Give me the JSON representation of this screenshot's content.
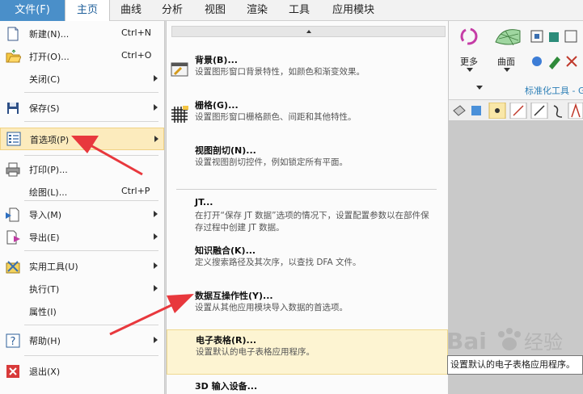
{
  "menubar": {
    "items": [
      {
        "label": "文件(F)"
      },
      {
        "label": "主页"
      },
      {
        "label": "曲线"
      },
      {
        "label": "分析"
      },
      {
        "label": "视图"
      },
      {
        "label": "渲染"
      },
      {
        "label": "工具"
      },
      {
        "label": "应用模块"
      }
    ]
  },
  "ribbon": {
    "more_label": "更多",
    "surface_label": "曲面",
    "group_label": "标准化工具 - G"
  },
  "file_menu": {
    "items": [
      {
        "label": "新建(N)...",
        "shortcut": "Ctrl+N"
      },
      {
        "label": "打开(O)...",
        "shortcut": "Ctrl+O"
      },
      {
        "label": "关闭(C)"
      },
      {
        "label": "保存(S)"
      },
      {
        "label": "首选项(P)"
      },
      {
        "label": "打印(P)..."
      },
      {
        "label": "绘图(L)...",
        "shortcut": "Ctrl+P"
      },
      {
        "label": "导入(M)"
      },
      {
        "label": "导出(E)"
      },
      {
        "label": "实用工具(U)"
      },
      {
        "label": "执行(T)"
      },
      {
        "label": "属性(I)"
      },
      {
        "label": "帮助(H)"
      },
      {
        "label": "退出(X)"
      }
    ]
  },
  "sub_menu": {
    "items": [
      {
        "title": "背景(B)...",
        "desc": "设置图形窗口背景特性，如颜色和渐变效果。"
      },
      {
        "title": "栅格(G)...",
        "desc": "设置图形窗口栅格颜色、间距和其他特性。"
      },
      {
        "title": "视图剖切(N)...",
        "desc": "设置视图剖切控件，例如锁定所有平面。"
      },
      {
        "title": "JT...",
        "desc": "在打开“保存 JT 数据”选项的情况下，设置配置参数以在部件保存过程中创建 JT 数据。"
      },
      {
        "title": "知识融合(K)...",
        "desc": "定义搜索路径及其次序，以查找 DFA 文件。"
      },
      {
        "title": "数据互操作性(Y)...",
        "desc": "设置从其他应用模块导入数据的首选项。"
      },
      {
        "title": "电子表格(R)...",
        "desc": "设置默认的电子表格应用程序。"
      },
      {
        "title": "3D 输入设备..."
      }
    ]
  },
  "tooltip": {
    "text": "设置默认的电子表格应用程序。"
  },
  "watermark": {
    "text": "Bai 经验"
  },
  "colors": {
    "accent": "#4a8fc9",
    "highlight": "#fcebbd",
    "arrow": "#e8383d"
  }
}
